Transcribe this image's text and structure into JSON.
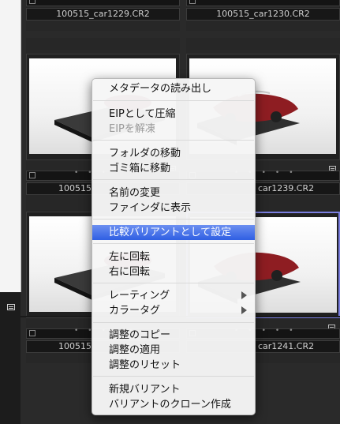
{
  "files": {
    "row0_left": "100515_car1229.CR2",
    "row0_right": "100515_car1230.CR2",
    "row1_left": "100515",
    "row1_right": "car1239.CR2",
    "row2_left": "100515",
    "row2_right": "car1241.CR2"
  },
  "colors": {
    "background": "#2a2a2a",
    "menu_highlight": "#3f6be6",
    "selection_border": "#7a7ee0",
    "car_body": "#8e1d22"
  },
  "menu": {
    "read_metadata": "メタデータの読み出し",
    "compress_as_eip": "EIPとして圧縮",
    "uncompress_eip": "EIPを解凍",
    "move_folder": "フォルダの移動",
    "move_to_trash": "ゴミ箱に移動",
    "rename": "名前の変更",
    "show_in_finder": "ファインダに表示",
    "set_as_compare_variant": "比較バリアントとして設定",
    "rotate_left": "左に回転",
    "rotate_right": "右に回転",
    "rating": "レーティング",
    "color_tag": "カラータグ",
    "copy_adjustments": "調整のコピー",
    "apply_adjustments": "調整の適用",
    "reset_adjustments": "調整のリセット",
    "new_variant": "新規バリアント",
    "clone_variant": "バリアントのクローン作成"
  }
}
